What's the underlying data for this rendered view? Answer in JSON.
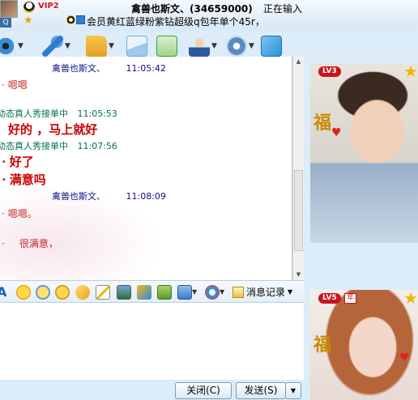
{
  "header": {
    "vip_label": "VIP2",
    "contact_title": "禽兽也斯文、(34659000)",
    "status": "正在输入",
    "signature": "会员黄红蓝绿粉紫钻超级q包年单个45r，",
    "avatar_badge": "Q"
  },
  "toolbar": {
    "items": [
      {
        "icon": "video-call-icon",
        "color": "#3a8ad8"
      },
      {
        "icon": "voice-call-icon",
        "color": "#2f7bd0"
      },
      {
        "icon": "send-file-icon",
        "color": "#e5a020"
      },
      {
        "icon": "send-mail-icon",
        "color": "#6bb0e0"
      },
      {
        "icon": "create-group-icon",
        "color": "#3aa03a"
      },
      {
        "icon": "remote-assist-icon",
        "color": "#2a5a9a"
      },
      {
        "icon": "app-settings-icon",
        "color": "#5a8ac0"
      },
      {
        "icon": "share-icon",
        "color": "#2a90d8"
      }
    ]
  },
  "chat": {
    "messages": [
      {
        "sender": "禽兽也斯文、",
        "time": "11:05:42",
        "text": "嗯嗯"
      },
      {
        "sender": "动态真人秀接单中",
        "time": "11:05:53",
        "text": "好的 ，马上就好"
      },
      {
        "sender": "动态真人秀接单中",
        "time": "11:07:56",
        "text": "好了"
      },
      {
        "sender": "",
        "time": "",
        "text": "满意吗"
      },
      {
        "sender": "禽兽也斯文、",
        "time": "11:08:09",
        "text": "嗯嗯。"
      },
      {
        "sender": "",
        "time": "",
        "text": "很满意，"
      }
    ],
    "bullet": "·"
  },
  "format_toolbar": {
    "font_label": "A",
    "message_record": "消息记录"
  },
  "buttons": {
    "close": "关闭(C)",
    "send": "发送(S)"
  },
  "right_panel": {
    "lv_top": "LV3",
    "lv_bottom": "LV5",
    "year_badge": "年"
  }
}
